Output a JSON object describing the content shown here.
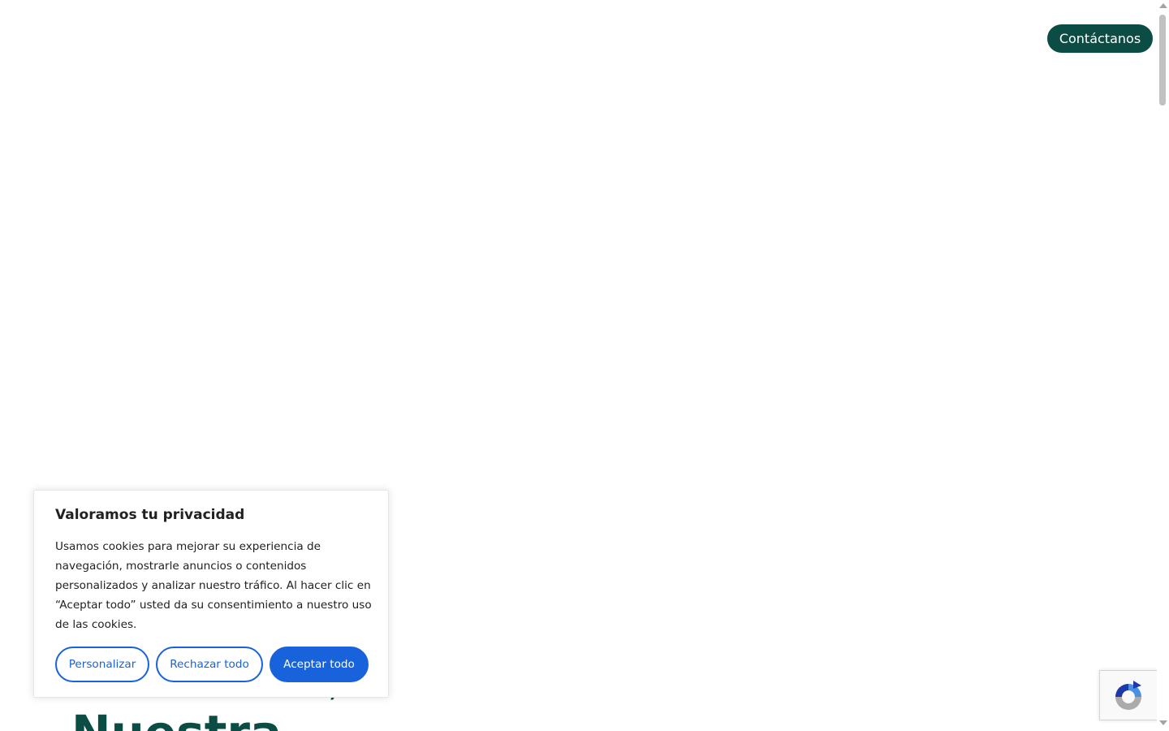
{
  "header": {
    "contact_label": "Contáctanos"
  },
  "hero": {
    "fragment_text": "Nuestra",
    "fragment_punct": ","
  },
  "cookie_banner": {
    "title": "Valoramos tu privacidad",
    "description": "Usamos cookies para mejorar su experiencia de navegación, mostrarle anuncios o contenidos personalizados y analizar nuestro tráfico. Al hacer clic en “Aceptar todo” usted da su consentimiento a nuestro uso de las cookies.",
    "buttons": {
      "customize": "Personalizar",
      "reject": "Rechazar todo",
      "accept": "Aceptar todo"
    }
  },
  "colors": {
    "brand_green": "#0b4d44",
    "cookie_accent": "#1863dc",
    "text_dark": "#212121"
  },
  "icons": {
    "recaptcha": "recaptcha-logo-icon"
  }
}
